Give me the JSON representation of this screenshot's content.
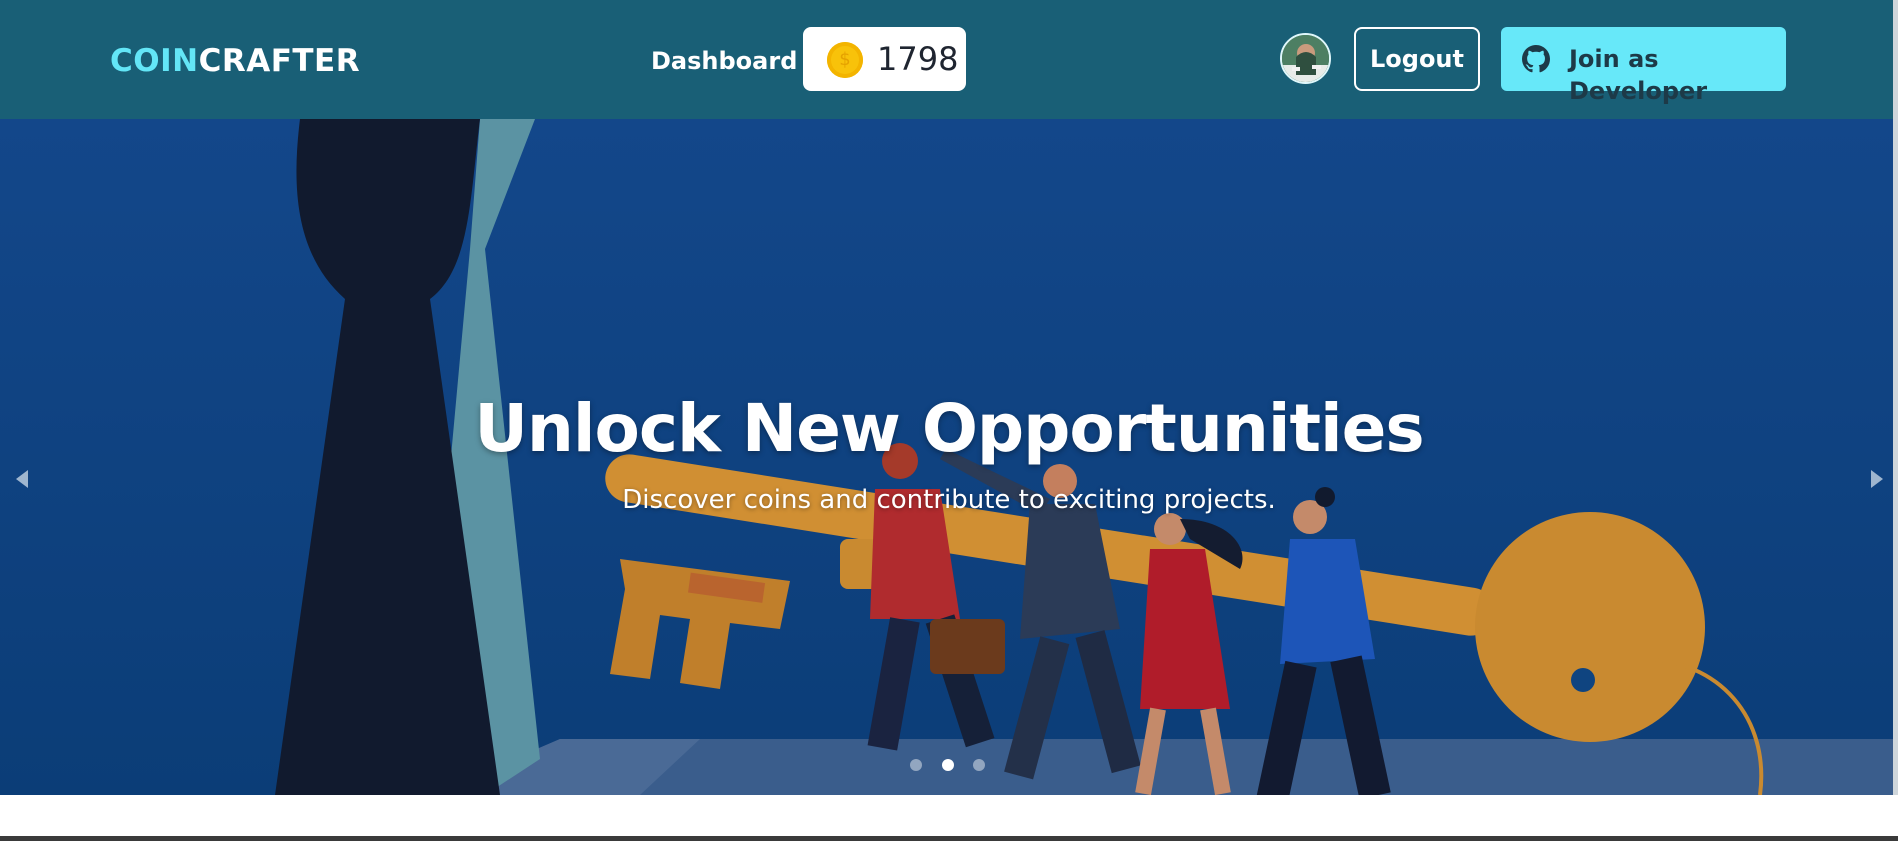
{
  "brand": {
    "part1": "COIN",
    "part2": "CRAFTER"
  },
  "nav": {
    "dashboard_label": "Dashboard",
    "coin_symbol": "$",
    "coin_balance": "1798",
    "logout_label": "Logout",
    "developer_label": "Join as Developer"
  },
  "hero": {
    "title": "Unlock New Opportunities",
    "subtitle": "Discover coins and contribute to exciting projects.",
    "active_slide": 2,
    "slide_count": 3
  },
  "colors": {
    "header_bg": "#195f76",
    "brand_accent": "#63e6f7",
    "developer_button_bg": "#67e8f9",
    "coin_gold": "#f8c20a",
    "hero_bg": "#0f4480"
  },
  "icons": {
    "coin": "coin-icon",
    "github": "github-icon",
    "prev": "chevron-left-icon",
    "next": "chevron-right-icon"
  }
}
